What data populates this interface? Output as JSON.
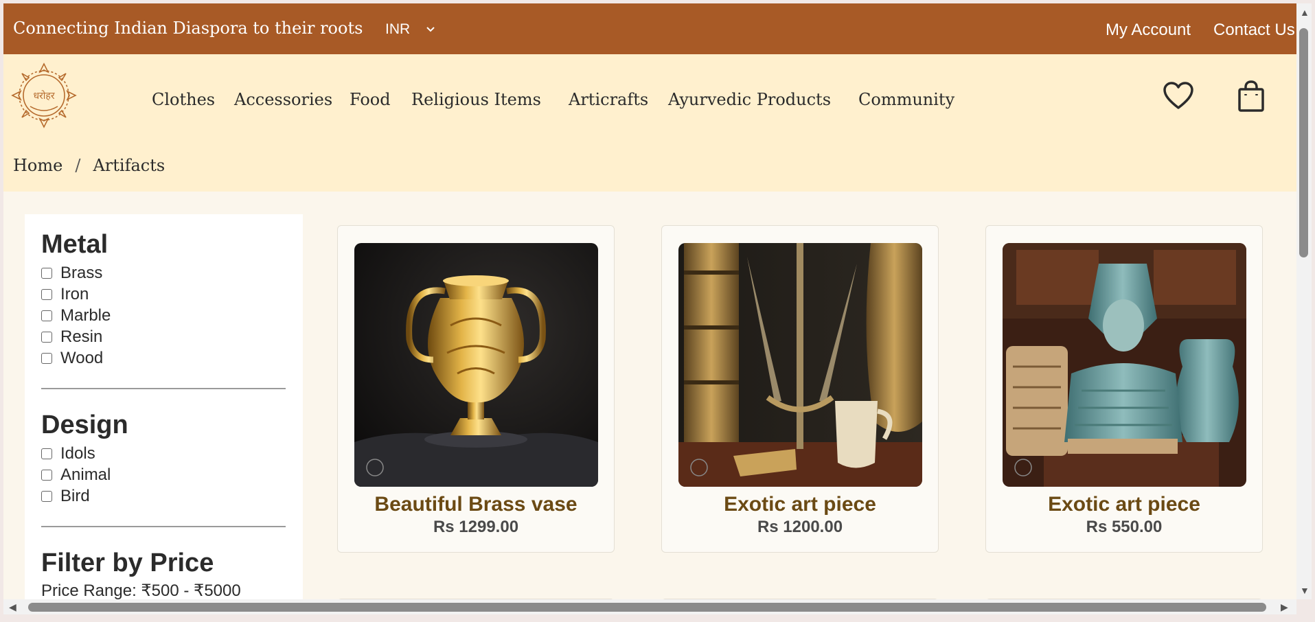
{
  "topbar": {
    "tagline": "Connecting Indian Diaspora to their roots",
    "currency": "INR",
    "links": {
      "account": "My Account",
      "contact": "Contact Us"
    }
  },
  "header": {
    "logo_alt": "धरोहर",
    "nav": [
      "Clothes",
      "Accessories",
      "Food",
      "Religious Items",
      "Articrafts",
      "Ayurvedic Products",
      "Community"
    ],
    "icons": [
      "heart-icon",
      "shopping-bag-icon"
    ]
  },
  "breadcrumb": {
    "home": "Home",
    "separator": "/",
    "current": "Artifacts"
  },
  "filters": {
    "metal": {
      "title": "Metal",
      "options": [
        "Brass",
        "Iron",
        "Marble",
        "Resin",
        "Wood"
      ]
    },
    "design": {
      "title": "Design",
      "options": [
        "Idols",
        "Animal",
        "Bird"
      ]
    },
    "price": {
      "title": "Filter by Price",
      "range_label": "Price Range: ₹500 - ₹5000"
    }
  },
  "products": [
    {
      "name": "Beautiful Brass vase",
      "price": "Rs 1299.00"
    },
    {
      "name": "Exotic art piece",
      "price": "Rs 1200.00"
    },
    {
      "name": "Exotic art piece",
      "price": "Rs 550.00"
    }
  ],
  "colors": {
    "topbar": "#a85a26",
    "header_bg": "#fff0ce",
    "product_name": "#6b4a14"
  }
}
